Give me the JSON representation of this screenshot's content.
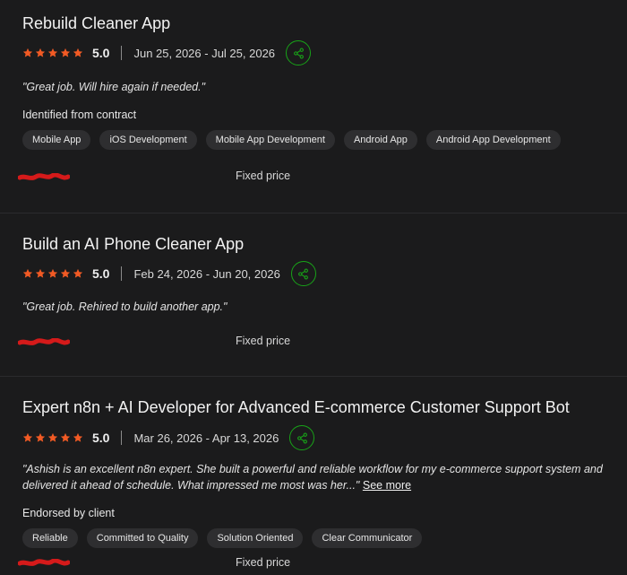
{
  "colors": {
    "background": "#1b1b1c",
    "star": "#f15a24",
    "share_accent": "#18a318",
    "redaction": "#d51a1a",
    "chip_bg": "#2e2e30"
  },
  "jobs": [
    {
      "title": "Rebuild Cleaner App",
      "rating": "5.0",
      "stars": 5,
      "dates": "Jun 25, 2026 - Jul 25, 2026",
      "feedback": "\"Great job. Will hire again if needed.\"",
      "section_label": "Identified from contract",
      "chips": [
        "Mobile App",
        "iOS Development",
        "Mobile App Development",
        "Android App",
        "Android App Development"
      ],
      "price_type": "Fixed price"
    },
    {
      "title": "Build an AI Phone Cleaner App",
      "rating": "5.0",
      "stars": 5,
      "dates": "Feb 24, 2026 - Jun 20, 2026",
      "feedback": "\"Great job. Rehired to build another app.\"",
      "price_type": "Fixed price"
    },
    {
      "title": "Expert n8n + AI Developer for Advanced E-commerce Customer Support Bot",
      "rating": "5.0",
      "stars": 5,
      "dates": "Mar 26, 2026 - Apr 13, 2026",
      "feedback": "\"Ashish is an excellent n8n expert. She built a powerful and reliable workflow for my e-commerce support system and delivered it ahead of schedule. What impressed me most was her...\"",
      "see_more": "See more",
      "section_label": "Endorsed by client",
      "chips": [
        "Reliable",
        "Committed to Quality",
        "Solution Oriented",
        "Clear Communicator"
      ],
      "price_type": "Fixed price"
    }
  ]
}
